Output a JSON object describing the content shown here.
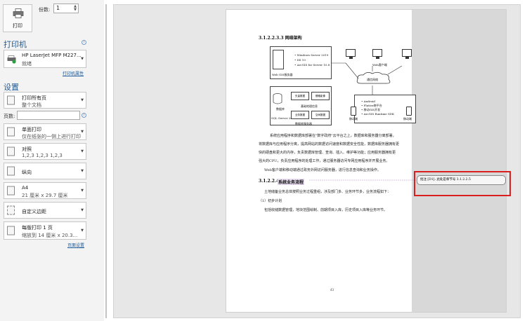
{
  "print_panel": {
    "print_button_label": "打印",
    "copies_label": "份数:",
    "copies_value": "1",
    "printer_section_title": "打印机",
    "printer_name": "HP LaserJet MFP M227...",
    "printer_status": "就绪",
    "printer_properties_link": "打印机属性",
    "settings_section_title": "设置",
    "pages_label": "页数:",
    "settings": [
      {
        "title": "打印所有页",
        "subtitle": "整个文档"
      },
      {
        "title": "单面打印",
        "subtitle": "仅在纸张的一侧上进行打印"
      },
      {
        "title": "对照",
        "subtitle": "1,2,3    1,2,3    1,2,3"
      },
      {
        "title": "纵向",
        "subtitle": ""
      },
      {
        "title": "A4",
        "subtitle": "21 厘米 x 29.7 厘米"
      },
      {
        "title": "自定义边距",
        "subtitle": ""
      },
      {
        "title": "每版打印 1 页",
        "subtitle": "缩放到 14 厘米 x 20.3..."
      }
    ],
    "page_setup_link": "页面设置"
  },
  "preview": {
    "heading_arch": "3.1.2.2.3.3 网络架构",
    "diagram": {
      "web_server_label": "Web GIS服务器",
      "server_specs": [
        "• Windows Server 2019",
        "• IIS 10",
        "• ArcGIS for Server 10.8"
      ],
      "web_client_label": "Web客户端",
      "internet_label": "通信网络",
      "db_label": "数据库",
      "sql_label": "SQL Server 2019",
      "db_server_label": "数据库服务器",
      "gis_boxes": [
        "矢量数据",
        "栅格影像",
        "业务数据",
        "空间数据"
      ],
      "gis_caption": "基础地理信息",
      "mobile_specs": [
        "• Android",
        "• Flutter跨平台",
        "• 移动GIS开发",
        "• ArcGIS Runtime SDK"
      ],
      "mobile_label": "移动端"
    },
    "paragraph_1": [
      "系统应用程序和数据库部署在\"数字政府\"云平台之上，数据库和服务器分离部署，",
      "将数据库与应用程序分离，提高网站的数据访问速度和数据安全性能，数据库服务器拥有更",
      "快的硬盘和更大的内存，负责数据库管理、查询、插入、维护等功能；应用服务器拥有更",
      "强大的CPU，负责应用程序的处理工作，通过服务器访问专网应用程序并开展业务。"
    ],
    "paragraph_2": "Web客户端和移动端通过政务外网访问服务器，进行信息查询和业务操作。",
    "heading_flow": "3.1.2.2.4",
    "heading_flow_title": "系统业务流程",
    "paragraph_3": "土地储备业务总体按照业务过程重组，涉及部门多、业务环节多，业务流程如下：",
    "list_item": "（1）初步计划",
    "paragraph_4": "包括收储数据管理，地块范围绘制、前期项目入库，历史项目入库等业务环节。",
    "page_number": "43",
    "comment_text": "批注 [D1]: 此处是章节号 3.1.2.2.5"
  }
}
